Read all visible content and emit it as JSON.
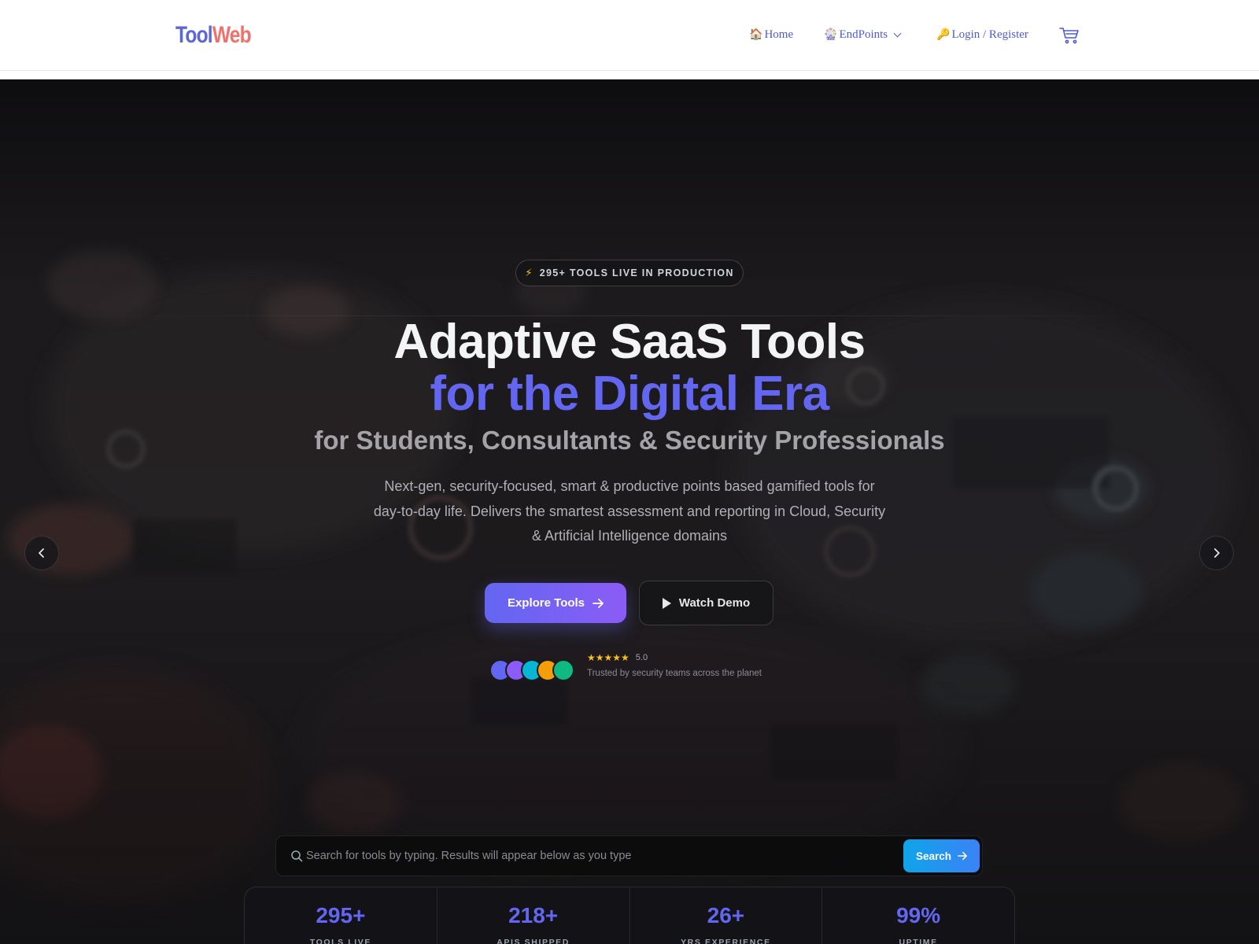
{
  "brand": {
    "part1": "Tool",
    "part2": "Web"
  },
  "nav": {
    "home_icon": "🏠",
    "home": "Home",
    "endpoints_icon": "🎡",
    "endpoints": "EndPoints",
    "login_icon": "🔑",
    "login": "Login / Register",
    "cart_icon": "cart-icon"
  },
  "hero": {
    "badge": "295+ TOOLS LIVE IN PRODUCTION",
    "badge_icon": "⚡",
    "title_line1": "Adaptive SaaS Tools",
    "title_line2": "for the Digital Era",
    "subtitle": "for Students, Consultants & Security Professionals",
    "description": "Next-gen, security-focused, smart & productive points based gamified tools for day-to-day life. Delivers the smartest assessment and reporting in Cloud, Security & Artificial Intelligence domains",
    "explore_label": "Explore Tools",
    "demo_label": "Watch Demo",
    "rating_stars": "★★★★★",
    "rating_value": "5.0",
    "trust_text": "Trusted by security teams across the planet",
    "avatar_colors": [
      "#6366f1",
      "#8b5cf6",
      "#06b6d4",
      "#f59e0b",
      "#10b981"
    ]
  },
  "search": {
    "placeholder": "Search for tools by typing. Results will appear below as you type",
    "button": "Search"
  },
  "stats": [
    {
      "value": "295+",
      "label": "TOOLS LIVE"
    },
    {
      "value": "218+",
      "label": "APIS SHIPPED"
    },
    {
      "value": "26+",
      "label": "YRS EXPERIENCE"
    },
    {
      "value": "99%",
      "label": "UPTIME"
    }
  ],
  "colors": {
    "accent": "#6366f1",
    "brand_blue": "#5b67d8",
    "brand_red": "#f0716c",
    "search_button": "#0ea5e9"
  }
}
